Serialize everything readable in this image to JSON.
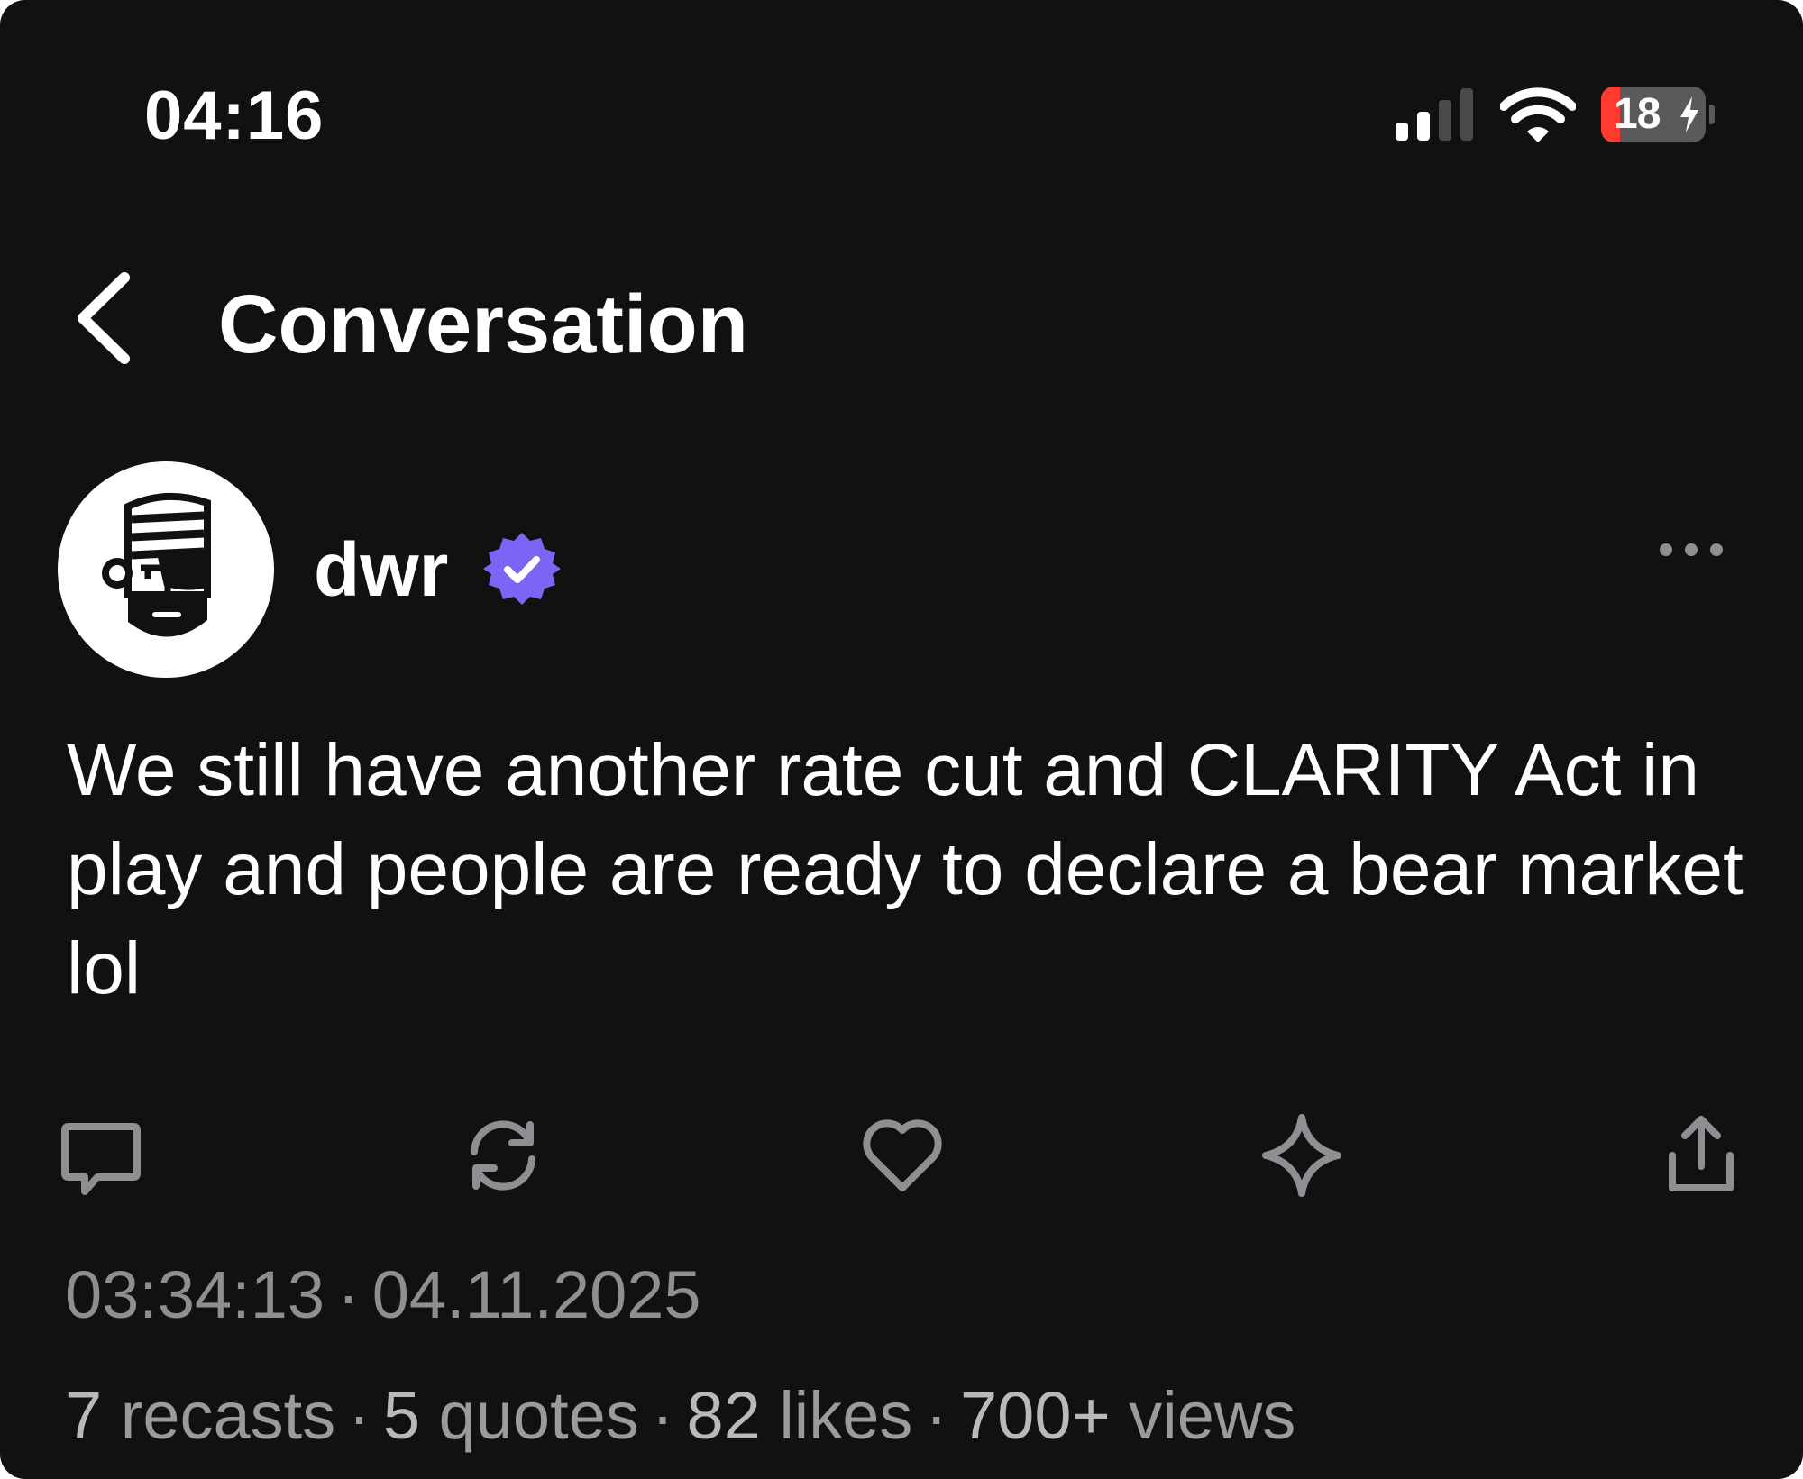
{
  "status_bar": {
    "time": "04:16",
    "battery_level": "18",
    "battery_fraction": 0.18,
    "icons": [
      "signal-icon",
      "wifi-icon",
      "battery-icon",
      "charging-bolt-icon"
    ],
    "battery_low_color": "#ff3b30"
  },
  "header": {
    "title": "Conversation",
    "back_icon": "chevron-left-icon"
  },
  "post": {
    "author_name": "dwr",
    "verified_icon": "verified-badge-icon",
    "verified_color": "#7c65f5",
    "more_icon": "more-horizontal-icon",
    "text": "We still have another rate cut and CLARITY Act in play and people are ready to declare a bear market lol",
    "actions": [
      "reply-icon",
      "recast-icon",
      "like-icon",
      "bookmark-icon",
      "share-icon"
    ],
    "time": "03:34:13",
    "date": "04.11.2025",
    "stats": {
      "recasts_count": "7",
      "recasts_label": "recasts",
      "quotes_count": "5",
      "quotes_label": "quotes",
      "likes_count": "82",
      "likes_label": "likes",
      "views_count": "700+",
      "views_label": "views"
    }
  },
  "colors": {
    "background": "#111111",
    "text_primary": "#ffffff",
    "text_secondary": "#8e8e93",
    "accent": "#7c65f5"
  }
}
